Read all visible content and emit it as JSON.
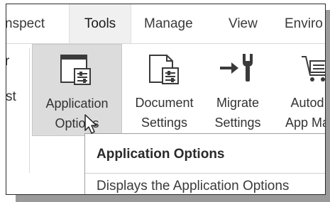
{
  "tabs": [
    {
      "label": "nspect",
      "active": false
    },
    {
      "label": "Tools",
      "active": true
    },
    {
      "label": "Manage",
      "active": false
    },
    {
      "label": "View",
      "active": false
    },
    {
      "label": "Enviro",
      "active": false
    }
  ],
  "left_panel": {
    "cut_label_top": "r",
    "cut_label_bottom": "st"
  },
  "commands": [
    {
      "line1": "Application",
      "line2": "Options",
      "icon": "application-options-icon",
      "hovered": true
    },
    {
      "line1": "Document",
      "line2": "Settings",
      "icon": "document-settings-icon",
      "hovered": false
    },
    {
      "line1": "Migrate",
      "line2": "Settings",
      "icon": "migrate-settings-icon",
      "hovered": false
    },
    {
      "line1": "Autod",
      "line2": "App Ma",
      "icon": "app-manager-icon",
      "hovered": false
    }
  ],
  "tooltip": {
    "title": "Application Options",
    "description": "Displays the Application Options"
  }
}
